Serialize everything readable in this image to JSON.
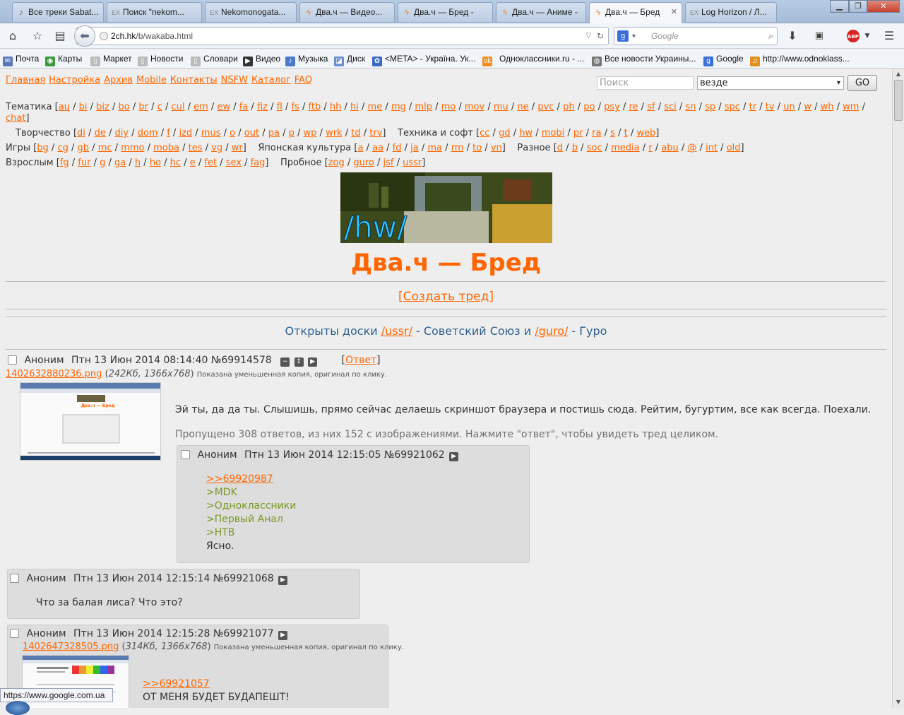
{
  "tabs": [
    {
      "label": "Все треки Sabat...",
      "icon": "speaker-icon"
    },
    {
      "label": "Поиск \"nekom...",
      "icon": "ex-icon"
    },
    {
      "label": "Nekomonogata...",
      "icon": "ex-icon"
    },
    {
      "label": "Два.ч — Видео...",
      "icon": "2ch-bolt-icon"
    },
    {
      "label": "Два.ч — Бред -",
      "icon": "2ch-bolt-icon"
    },
    {
      "label": "Два.ч — Аниме -",
      "icon": "2ch-bolt-icon"
    },
    {
      "label": "Два.ч — Бред",
      "icon": "2ch-bolt-icon"
    },
    {
      "label": "Log Horizon / Л...",
      "icon": "ex-icon"
    }
  ],
  "address": {
    "host": "2ch.hk",
    "path": "/b/wakaba.html"
  },
  "search_engine_placeholder": "Google",
  "bookmarks": [
    "Почта",
    "Карты",
    "Маркет",
    "Новости",
    "Словари",
    "Видео",
    "Музыка",
    "Диск",
    "<META> - Україна. Ук...",
    "Одноклассники.ru - ...",
    "Все новости Украины...",
    "Google",
    "http://www.odnoklass..."
  ],
  "page": {
    "nav": [
      "Главная",
      "Настройка",
      "Архив",
      "Mobile",
      "Контакты",
      "NSFW",
      "Каталог",
      "FAQ"
    ],
    "search_placeholder": "Поиск",
    "search_scope": "везде",
    "go_label": "GO",
    "boards": {
      "themes_label": "Тематика",
      "themes": [
        "au",
        "bi",
        "biz",
        "bo",
        "br",
        "c",
        "cul",
        "em",
        "ew",
        "fa",
        "fiz",
        "fl",
        "fs",
        "ftb",
        "hh",
        "hi",
        "me",
        "mg",
        "mlp",
        "mo",
        "mov",
        "mu",
        "ne",
        "pvc",
        "ph",
        "po",
        "psy",
        "re",
        "sf",
        "sci",
        "sn",
        "sp",
        "spc",
        "tr",
        "tv",
        "un",
        "w",
        "wh",
        "wm",
        "chat"
      ],
      "creative_label": "Творчество",
      "creative": [
        "di",
        "de",
        "diy",
        "dom",
        "f",
        "izd",
        "mus",
        "o",
        "out",
        "pa",
        "p",
        "wp",
        "wrk",
        "td",
        "trv"
      ],
      "tech_label": "Техника и софт",
      "tech": [
        "cc",
        "gd",
        "hw",
        "mobi",
        "pr",
        "ra",
        "s",
        "t",
        "web"
      ],
      "games_label": "Игры",
      "games": [
        "bg",
        "cg",
        "gb",
        "mc",
        "mmo",
        "moba",
        "tes",
        "vg",
        "wr"
      ],
      "japan_label": "Японская культура",
      "japan": [
        "a",
        "aa",
        "fd",
        "ja",
        "ma",
        "rm",
        "to",
        "vn"
      ],
      "misc_label": "Разное",
      "misc": [
        "d",
        "b",
        "soc",
        "media",
        "r",
        "abu",
        "@",
        "int",
        "old"
      ],
      "adult_label": "Взрослым",
      "adult": [
        "fg",
        "fur",
        "g",
        "ga",
        "h",
        "ho",
        "hc",
        "e",
        "fet",
        "sex",
        "fag"
      ],
      "test_label": "Пробное",
      "test": [
        "zog",
        "guro",
        "jsf",
        "ussr"
      ]
    },
    "banner_text": "/hw/",
    "board_title": "Два.ч — Бред",
    "create_thread": "[Создать тред]",
    "notice": {
      "pre": "Открыты доски ",
      "link1": "/ussr/",
      "mid": " - Советский Союз и ",
      "link2": "/guro/",
      "post": " - Гуро"
    },
    "op": {
      "name": "Аноним",
      "date": "Птн 13 Июн 2014 08:14:40",
      "num": "№69914578",
      "reply_label": "Ответ",
      "file": "1402632880236.png",
      "file_meta": "242Кб, 1366x768",
      "thumb_note": "Показана уменьшенная копия, оригинал по клику.",
      "text": "Эй ты, да да ты. Слышишь, прямо сейчас делаешь скриншот браузера и постишь сюда. Рейтим, бугуртим, все как всегда. Поехали.",
      "omitted": "Пропущено 308 ответов, из них 152 с изображениями. Нажмите \"ответ\", чтобы увидеть тред целиком."
    },
    "replies": [
      {
        "name": "Аноним",
        "date": "Птн 13 Июн 2014 12:15:05",
        "num": "№69921062",
        "ref": ">>69920987",
        "quotes": [
          ">MDK",
          ">Одноклассники",
          ">Первый Анал",
          ">НТВ"
        ],
        "text": "Ясно."
      },
      {
        "name": "Аноним",
        "date": "Птн 13 Июн 2014 12:15:14",
        "num": "№69921068",
        "text": "Что за балая лиса? Что это?"
      },
      {
        "name": "Аноним",
        "date": "Птн 13 Июн 2014 12:15:28",
        "num": "№69921077",
        "file": "1402647328505.png",
        "file_meta": "314Кб, 1366x768",
        "thumb_note": "Показана уменьшенная копия, оригинал по клику.",
        "ref": ">>69921057",
        "text": "ОТ МЕНЯ БУДЕТ БУДАПЕШТ!"
      }
    ]
  },
  "status_url": "https://www.google.com.ua",
  "colors": {
    "link": "#ff6600",
    "quote": "#789922",
    "notice": "#2f5f8f",
    "reply_bg": "#dddddd",
    "page_bg": "#eeeeee"
  }
}
